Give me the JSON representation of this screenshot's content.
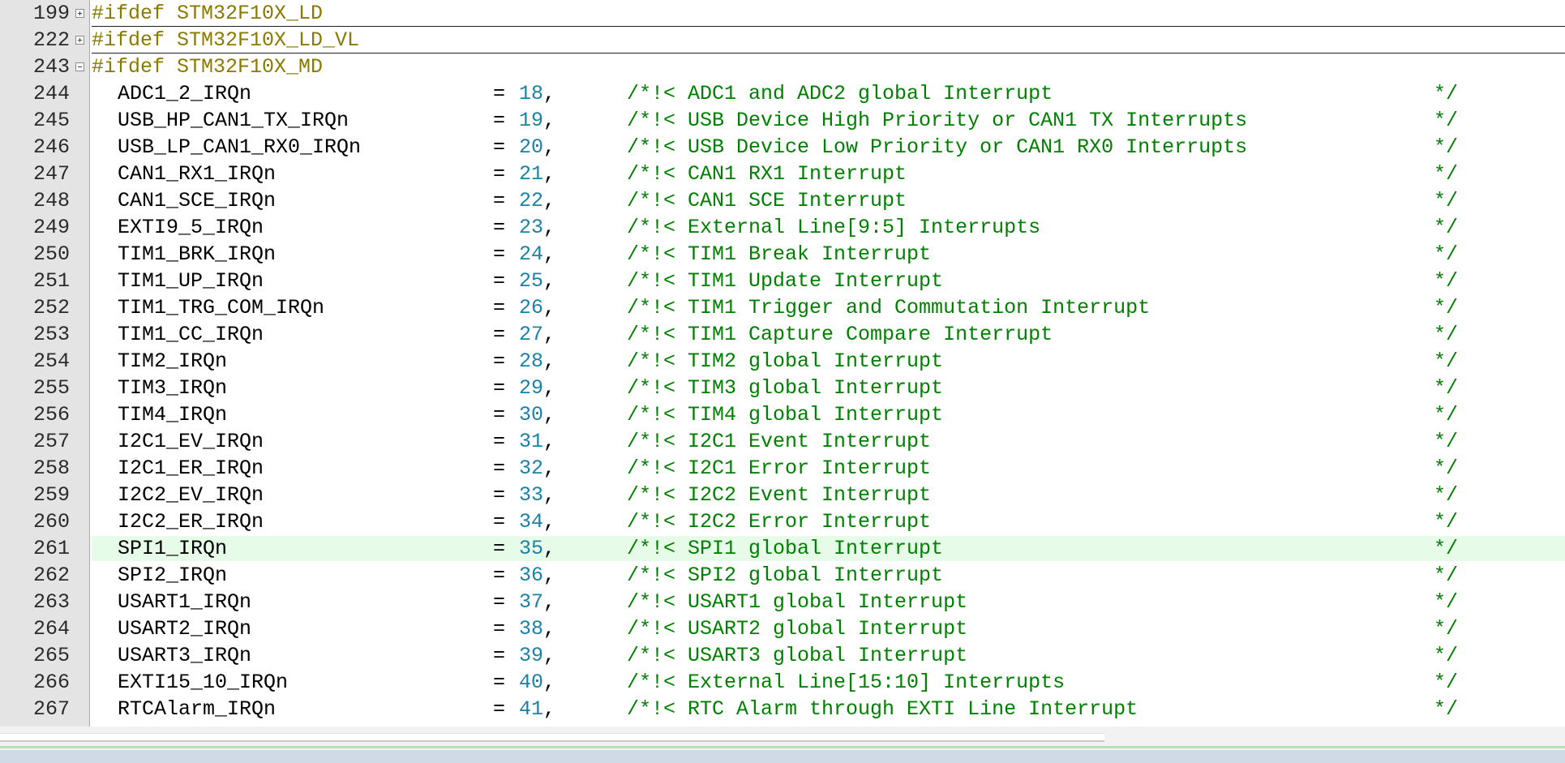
{
  "editor": {
    "fold_lines": [
      {
        "num": "199",
        "text": "#ifdef STM32F10X_LD",
        "state": "collapsed"
      },
      {
        "num": "222",
        "text": "#ifdef STM32F10X_LD_VL",
        "state": "collapsed"
      },
      {
        "num": "243",
        "text": "#ifdef STM32F10X_MD",
        "state": "expanded"
      }
    ],
    "enum_lines": [
      {
        "num": "244",
        "name": "ADC1_2_IRQn",
        "value": "18",
        "comment": "/*!< ADC1 and ADC2 global Interrupt"
      },
      {
        "num": "245",
        "name": "USB_HP_CAN1_TX_IRQn",
        "value": "19",
        "comment": "/*!< USB Device High Priority or CAN1 TX Interrupts"
      },
      {
        "num": "246",
        "name": "USB_LP_CAN1_RX0_IRQn",
        "value": "20",
        "comment": "/*!< USB Device Low Priority or CAN1 RX0 Interrupts"
      },
      {
        "num": "247",
        "name": "CAN1_RX1_IRQn",
        "value": "21",
        "comment": "/*!< CAN1 RX1 Interrupt"
      },
      {
        "num": "248",
        "name": "CAN1_SCE_IRQn",
        "value": "22",
        "comment": "/*!< CAN1 SCE Interrupt"
      },
      {
        "num": "249",
        "name": "EXTI9_5_IRQn",
        "value": "23",
        "comment": "/*!< External Line[9:5] Interrupts"
      },
      {
        "num": "250",
        "name": "TIM1_BRK_IRQn",
        "value": "24",
        "comment": "/*!< TIM1 Break Interrupt"
      },
      {
        "num": "251",
        "name": "TIM1_UP_IRQn",
        "value": "25",
        "comment": "/*!< TIM1 Update Interrupt"
      },
      {
        "num": "252",
        "name": "TIM1_TRG_COM_IRQn",
        "value": "26",
        "comment": "/*!< TIM1 Trigger and Commutation Interrupt"
      },
      {
        "num": "253",
        "name": "TIM1_CC_IRQn",
        "value": "27",
        "comment": "/*!< TIM1 Capture Compare Interrupt"
      },
      {
        "num": "254",
        "name": "TIM2_IRQn",
        "value": "28",
        "comment": "/*!< TIM2 global Interrupt"
      },
      {
        "num": "255",
        "name": "TIM3_IRQn",
        "value": "29",
        "comment": "/*!< TIM3 global Interrupt"
      },
      {
        "num": "256",
        "name": "TIM4_IRQn",
        "value": "30",
        "comment": "/*!< TIM4 global Interrupt"
      },
      {
        "num": "257",
        "name": "I2C1_EV_IRQn",
        "value": "31",
        "comment": "/*!< I2C1 Event Interrupt"
      },
      {
        "num": "258",
        "name": "I2C1_ER_IRQn",
        "value": "32",
        "comment": "/*!< I2C1 Error Interrupt"
      },
      {
        "num": "259",
        "name": "I2C2_EV_IRQn",
        "value": "33",
        "comment": "/*!< I2C2 Event Interrupt"
      },
      {
        "num": "260",
        "name": "I2C2_ER_IRQn",
        "value": "34",
        "comment": "/*!< I2C2 Error Interrupt"
      },
      {
        "num": "261",
        "name": "SPI1_IRQn",
        "value": "35",
        "comment": "/*!< SPI1 global Interrupt",
        "highlighted": true
      },
      {
        "num": "262",
        "name": "SPI2_IRQn",
        "value": "36",
        "comment": "/*!< SPI2 global Interrupt"
      },
      {
        "num": "263",
        "name": "USART1_IRQn",
        "value": "37",
        "comment": "/*!< USART1 global Interrupt"
      },
      {
        "num": "264",
        "name": "USART2_IRQn",
        "value": "38",
        "comment": "/*!< USART2 global Interrupt"
      },
      {
        "num": "265",
        "name": "USART3_IRQn",
        "value": "39",
        "comment": "/*!< USART3 global Interrupt"
      },
      {
        "num": "266",
        "name": "EXTI15_10_IRQn",
        "value": "40",
        "comment": "/*!< External Line[15:10] Interrupts"
      },
      {
        "num": "267",
        "name": "RTCAlarm_IRQn",
        "value": "41",
        "comment": "/*!< RTC Alarm through EXTI Line Interrupt"
      }
    ],
    "syntax": {
      "eq": "=",
      "comma": ",",
      "comment_end": "*/"
    },
    "colors": {
      "preprocessor": "#8a7a00",
      "number": "#1b82a6",
      "comment": "#008000",
      "current_line": "#e7fbe9",
      "gutter": "#e4e4e4"
    }
  }
}
